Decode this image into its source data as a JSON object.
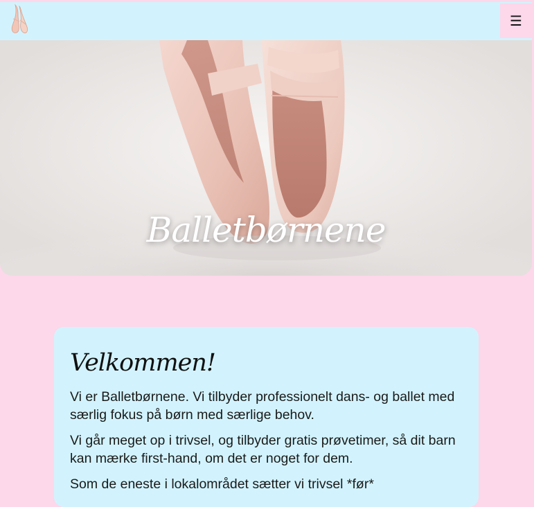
{
  "navbar": {
    "logo_icon": "ballet-shoe-logo-icon",
    "menu_icon": "hamburger-menu-icon",
    "menu_glyph": "☰"
  },
  "hero": {
    "title": "Balletbørnene",
    "image": "ballet-pointe-shoes-photo"
  },
  "welcome": {
    "heading": "Velkommen!",
    "paragraphs": [
      "Vi er Balletbørnene. Vi tilbyder professionelt dans- og ballet med særlig fokus på børn med særlige behov.",
      "Vi går meget op i trivsel, og tilbyder gratis prøvetimer, så dit barn kan mærke first-hand, om det er noget for dem.",
      "Som de eneste i lokalområdet sætter vi trivsel *før*"
    ]
  },
  "colors": {
    "page_background": "#fdd7ea",
    "navbar_background": "#d2f3fd",
    "card_background": "#d2f3fd",
    "menu_button_background": "#fdd7ea"
  }
}
